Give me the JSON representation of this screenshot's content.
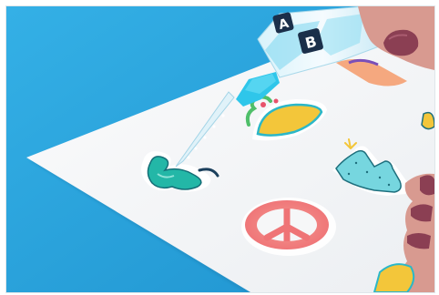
{
  "scene": {
    "colors": {
      "background_blue": "#2ea6dd",
      "paper_white": "#f6f7f8",
      "glue_bottle_cyan": "#2fc6ea",
      "taco_yellow": "#f3c63a",
      "taco_shell_teal": "#2bb7c8",
      "cactus_teal": "#76d6df",
      "peace_coral": "#f07a78",
      "ampersand_teal": "#23b7a7",
      "skin_tone": "#d89a90",
      "nail_polish": "#8b3f53"
    },
    "labels": {
      "bottle_label_a": "A",
      "bottle_label_b": "B"
    },
    "objects": [
      {
        "name": "glue-bottle",
        "icon": "glue-bottle-icon"
      },
      {
        "name": "taco-sticker",
        "icon": "taco-icon"
      },
      {
        "name": "cactus-sticker",
        "icon": "cactus-icon"
      },
      {
        "name": "peace-sign-sticker",
        "icon": "peace-sign-icon"
      },
      {
        "name": "ampersand-sticker",
        "icon": "ampersand-icon"
      },
      {
        "name": "left-hand",
        "icon": "hand-icon"
      },
      {
        "name": "right-hand",
        "icon": "hand-icon"
      }
    ]
  }
}
